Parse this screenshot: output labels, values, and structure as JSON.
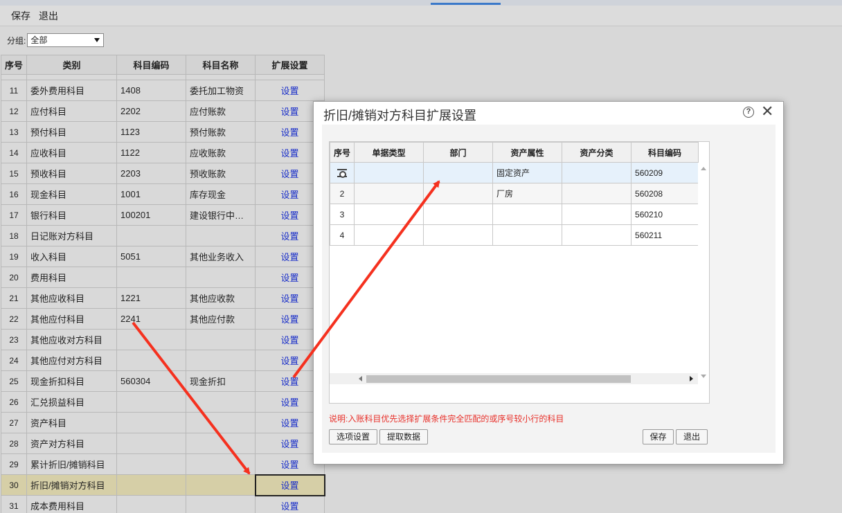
{
  "toolbar": {
    "save_label": "保存",
    "exit_label": "退出"
  },
  "filter": {
    "label": "分组:",
    "selected": "全部"
  },
  "grid": {
    "headers": [
      "序号",
      "类别",
      "科目编码",
      "科目名称",
      "扩展设置"
    ],
    "rows": [
      {
        "idx": "11",
        "category": "委外费用科目",
        "code": "1408",
        "name": "委托加工物资",
        "action": "设置"
      },
      {
        "idx": "12",
        "category": "应付科目",
        "code": "2202",
        "name": "应付账款",
        "action": "设置"
      },
      {
        "idx": "13",
        "category": "预付科目",
        "code": "1123",
        "name": "预付账款",
        "action": "设置"
      },
      {
        "idx": "14",
        "category": "应收科目",
        "code": "1122",
        "name": "应收账款",
        "action": "设置"
      },
      {
        "idx": "15",
        "category": "预收科目",
        "code": "2203",
        "name": "预收账款",
        "action": "设置"
      },
      {
        "idx": "16",
        "category": "现金科目",
        "code": "1001",
        "name": "库存现金",
        "action": "设置"
      },
      {
        "idx": "17",
        "category": "银行科目",
        "code": "100201",
        "name": "建设银行中…",
        "action": "设置"
      },
      {
        "idx": "18",
        "category": "日记账对方科目",
        "code": "",
        "name": "",
        "action": "设置"
      },
      {
        "idx": "19",
        "category": "收入科目",
        "code": "5051",
        "name": "其他业务收入",
        "action": "设置"
      },
      {
        "idx": "20",
        "category": "费用科目",
        "code": "",
        "name": "",
        "action": "设置"
      },
      {
        "idx": "21",
        "category": "其他应收科目",
        "code": "1221",
        "name": "其他应收款",
        "action": "设置"
      },
      {
        "idx": "22",
        "category": "其他应付科目",
        "code": "2241",
        "name": "其他应付款",
        "action": "设置"
      },
      {
        "idx": "23",
        "category": "其他应收对方科目",
        "code": "",
        "name": "",
        "action": "设置"
      },
      {
        "idx": "24",
        "category": "其他应付对方科目",
        "code": "",
        "name": "",
        "action": "设置"
      },
      {
        "idx": "25",
        "category": "现金折扣科目",
        "code": "560304",
        "name": "现金折扣",
        "action": "设置"
      },
      {
        "idx": "26",
        "category": "汇兑损益科目",
        "code": "",
        "name": "",
        "action": "设置"
      },
      {
        "idx": "27",
        "category": "资产科目",
        "code": "",
        "name": "",
        "action": "设置"
      },
      {
        "idx": "28",
        "category": "资产对方科目",
        "code": "",
        "name": "",
        "action": "设置"
      },
      {
        "idx": "29",
        "category": "累计折旧/摊销科目",
        "code": "",
        "name": "",
        "action": "设置"
      },
      {
        "idx": "30",
        "category": "折旧/摊销对方科目",
        "code": "",
        "name": "",
        "action": "设置"
      },
      {
        "idx": "31",
        "category": "成本费用科目",
        "code": "",
        "name": "",
        "action": "设置"
      }
    ]
  },
  "modal": {
    "title": "折旧/摊销对方科目扩展设置",
    "help_glyph": "?",
    "close_glyph": "✕",
    "headers": [
      "序号",
      "单据类型",
      "部门",
      "资产属性",
      "资产分类",
      "科目编码"
    ],
    "rows": [
      {
        "idx": "",
        "doc_type": "",
        "dept": "",
        "asset_attr": "固定资产",
        "asset_class": "",
        "code": "560209"
      },
      {
        "idx": "2",
        "doc_type": "",
        "dept": "",
        "asset_attr": "厂房",
        "asset_class": "",
        "code": "560208"
      },
      {
        "idx": "3",
        "doc_type": "",
        "dept": "",
        "asset_attr": "",
        "asset_class": "",
        "code": "560210"
      },
      {
        "idx": "4",
        "doc_type": "",
        "dept": "",
        "asset_attr": "",
        "asset_class": "",
        "code": "560211"
      }
    ],
    "note": "说明:入账科目优先选择扩展条件完全匹配的或序号较小行的科目",
    "options_label": "选项设置",
    "fetch_label": "提取数据",
    "save_label": "保存",
    "exit_label": "退出"
  },
  "colors": {
    "link": "#1a2fc9",
    "note": "#e8302a",
    "arrow": "#f5311f",
    "selected_row": "#d6cfa7",
    "accent": "#3b79c9"
  }
}
